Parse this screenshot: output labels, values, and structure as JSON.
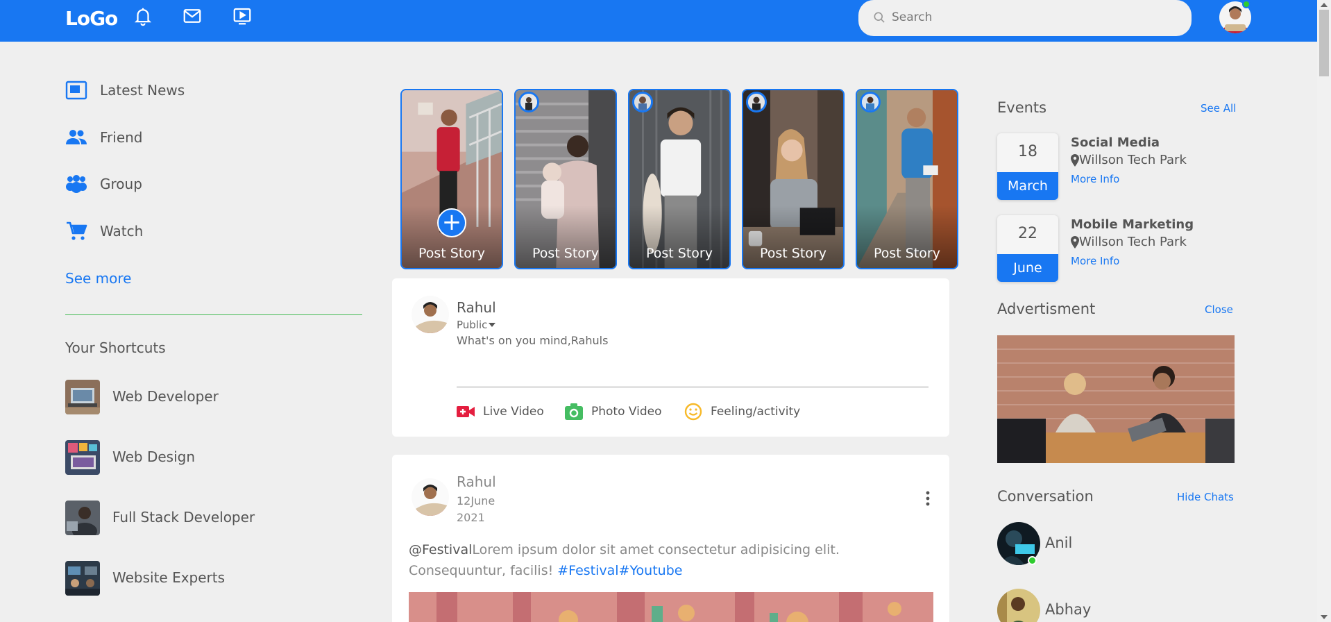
{
  "header": {
    "logo": "LoGo",
    "search_placeholder": "Search",
    "icons": [
      "bell-icon",
      "mail-icon",
      "video-play-icon"
    ]
  },
  "sidebar": {
    "items": [
      {
        "label": "Latest News",
        "icon": "news-icon"
      },
      {
        "label": "Friend",
        "icon": "friends-icon"
      },
      {
        "label": "Group",
        "icon": "group-icon"
      },
      {
        "label": "Watch",
        "icon": "cart-icon"
      }
    ],
    "see_more": "See more",
    "shortcuts_title": "Your Shortcuts",
    "shortcuts": [
      {
        "label": "Web Developer"
      },
      {
        "label": "Web Design"
      },
      {
        "label": "Full Stack Developer"
      },
      {
        "label": "Website Experts"
      }
    ]
  },
  "stories": [
    {
      "label": "Post Story"
    },
    {
      "label": "Post Story"
    },
    {
      "label": "Post Story"
    },
    {
      "label": "Post Story"
    },
    {
      "label": "Post Story"
    }
  ],
  "create_post": {
    "author": "Rahul",
    "visibility": "Public",
    "placeholder": "What's on you mind,Rahuls",
    "actions": [
      {
        "label": "Live Video"
      },
      {
        "label": "Photo Video"
      },
      {
        "label": "Feeling/activity"
      }
    ]
  },
  "feed_post": {
    "author": "Rahul",
    "date_line1": "12June",
    "date_line2": "2021",
    "mention": "@Festival",
    "body": "Lorem ipsum dolor sit amet consectetur adipisicing elit. Consequuntur, facilis! ",
    "tags": "#Festival#Youtube"
  },
  "events": {
    "title": "Events",
    "see_all": "See All",
    "items": [
      {
        "day": "18",
        "month": "March",
        "name": "Social Media",
        "place": "Willson Tech Park",
        "more": "More Info"
      },
      {
        "day": "22",
        "month": "June",
        "name": "Mobile Marketing",
        "place": "Willson Tech Park",
        "more": "More Info"
      }
    ]
  },
  "advertisement": {
    "title": "Advertisment",
    "close": "Close"
  },
  "conversation": {
    "title": "Conversation",
    "hide": "Hide Chats",
    "people": [
      {
        "name": "Anil",
        "online": true
      },
      {
        "name": "Abhay",
        "online": false
      }
    ]
  },
  "colors": {
    "brand": "#1877f2",
    "online": "#2fcc2f",
    "live_video": "#e41e3f",
    "photo": "#45bd62",
    "feeling": "#f7b928"
  }
}
